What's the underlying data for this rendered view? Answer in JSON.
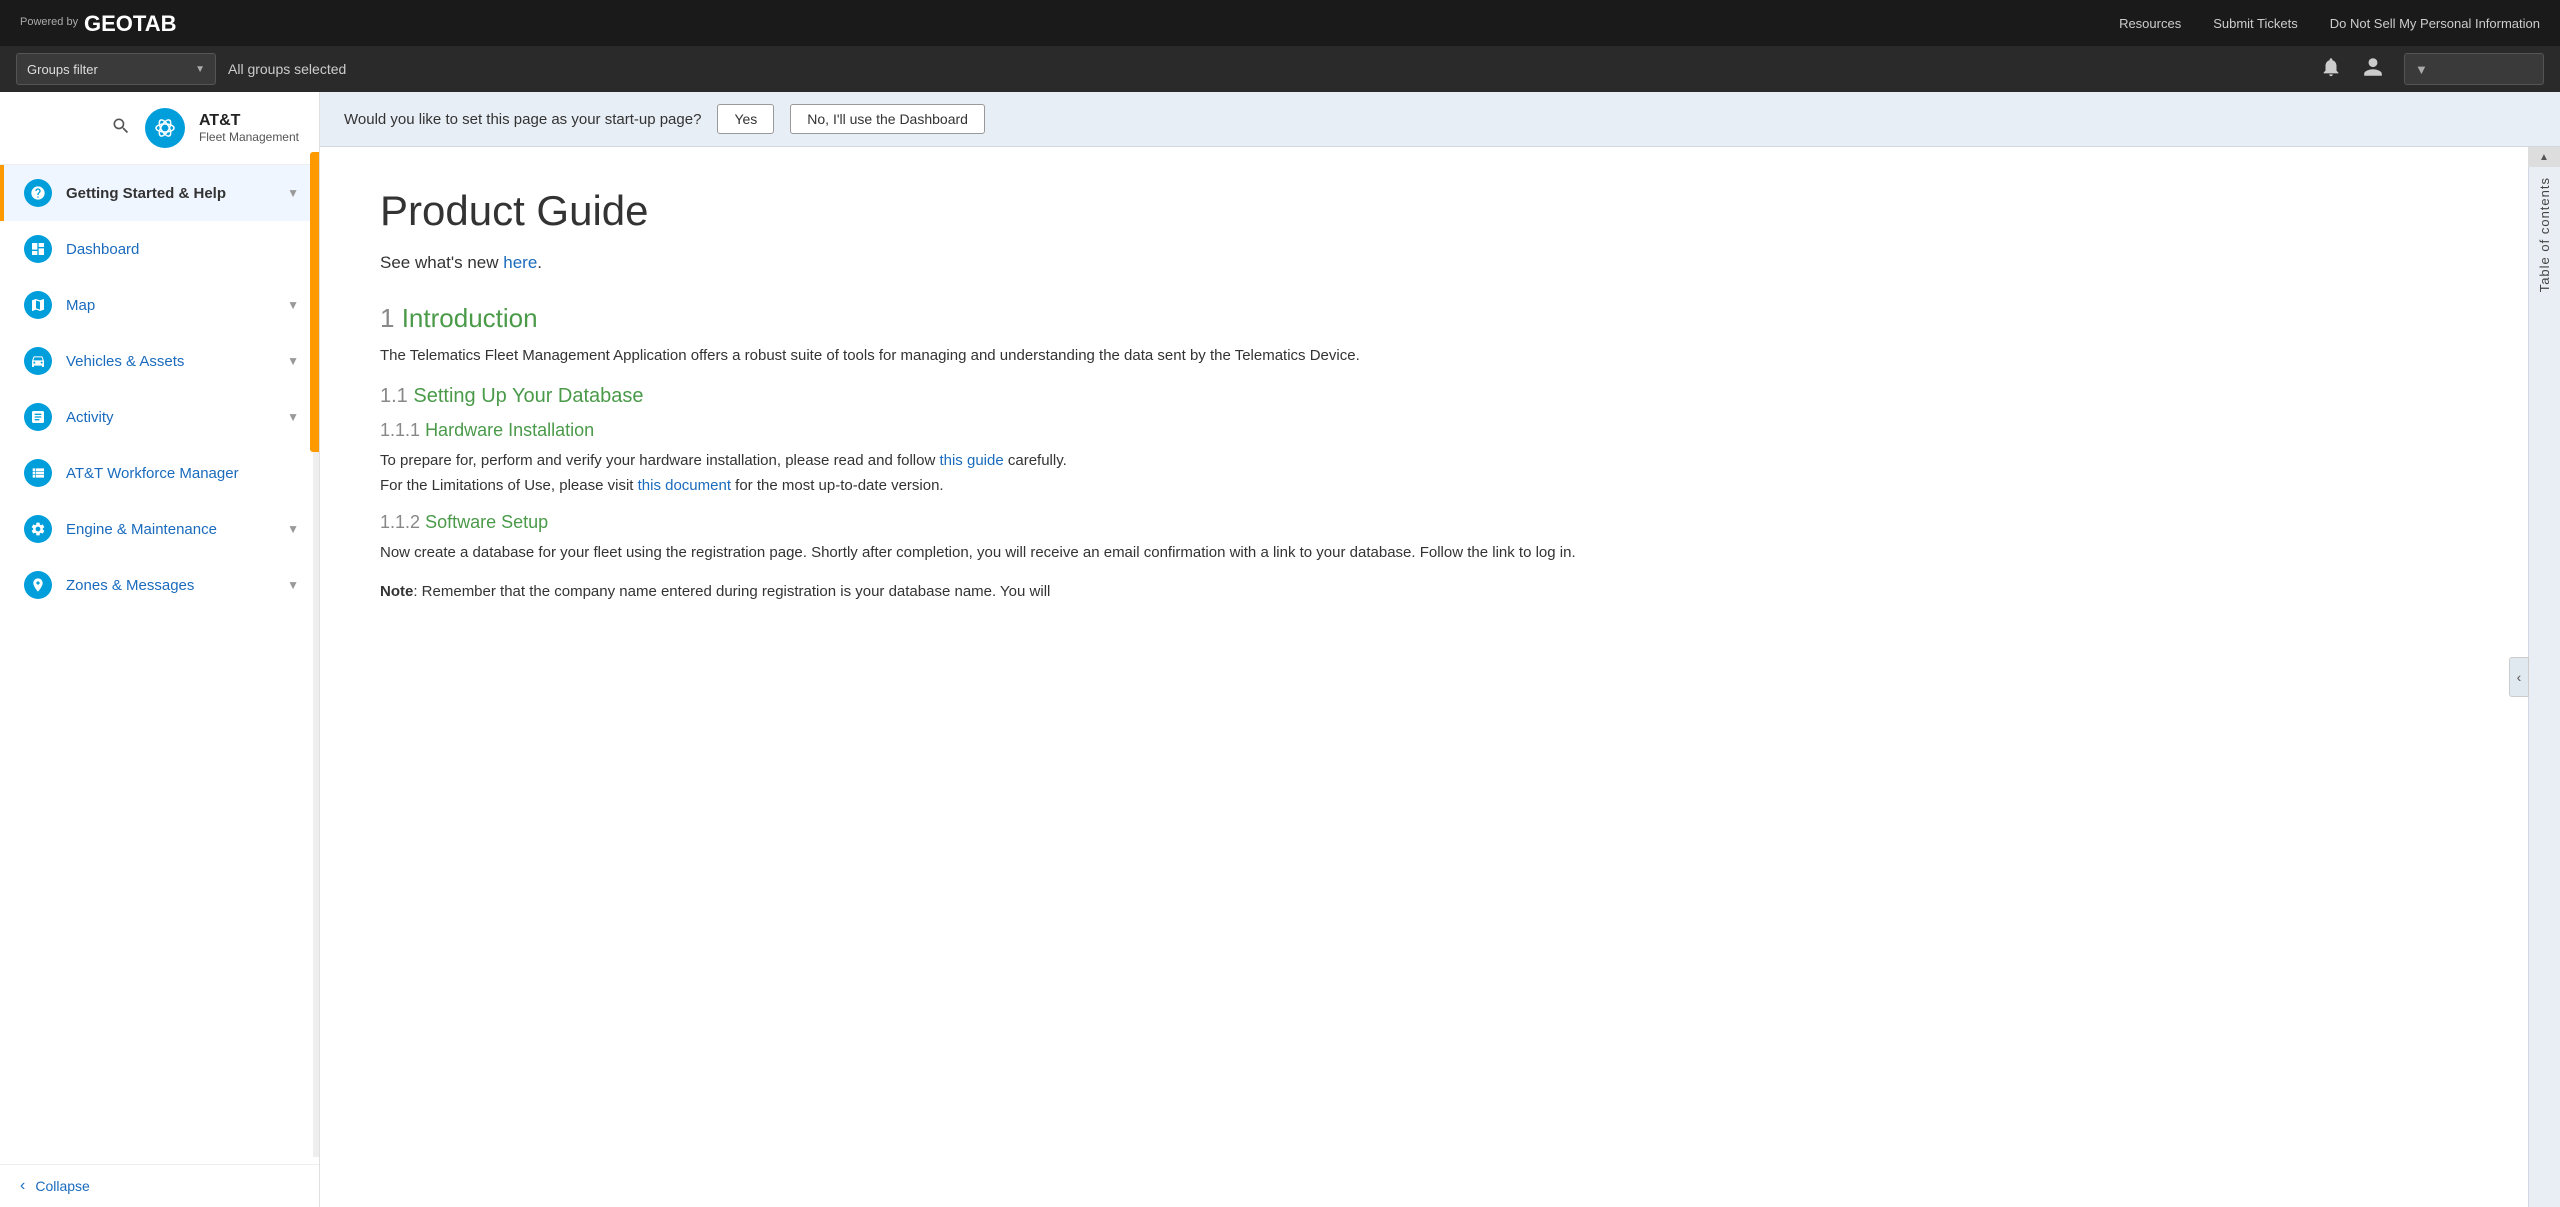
{
  "topbar": {
    "powered_by": "Powered\nby",
    "logo": "GEOTAB",
    "resources": "Resources",
    "submit_tickets": "Submit Tickets",
    "do_not_sell": "Do Not Sell My Personal Information"
  },
  "groups_bar": {
    "filter_label": "Groups filter",
    "dropdown_arrow": "▼",
    "all_groups": "All groups selected"
  },
  "sidebar": {
    "brand_name": "AT&T",
    "brand_sub": "Fleet Management",
    "nav_items": [
      {
        "id": "getting-started",
        "label": "Getting Started & Help",
        "active": true,
        "has_chevron": true
      },
      {
        "id": "dashboard",
        "label": "Dashboard",
        "active": false,
        "has_chevron": false
      },
      {
        "id": "map",
        "label": "Map",
        "active": false,
        "has_chevron": true
      },
      {
        "id": "vehicles",
        "label": "Vehicles & Assets",
        "active": false,
        "has_chevron": true
      },
      {
        "id": "activity",
        "label": "Activity",
        "active": false,
        "has_chevron": true
      },
      {
        "id": "workforce",
        "label": "AT&T Workforce Manager",
        "active": false,
        "has_chevron": false
      },
      {
        "id": "engine",
        "label": "Engine & Maintenance",
        "active": false,
        "has_chevron": true
      },
      {
        "id": "zones",
        "label": "Zones & Messages",
        "active": false,
        "has_chevron": true
      }
    ],
    "collapse_label": "Collapse"
  },
  "startup_banner": {
    "question": "Would you like to set this page as your start-up page?",
    "yes_btn": "Yes",
    "no_btn": "No, I'll use the Dashboard"
  },
  "toc": {
    "label": "Table of contents",
    "collapse_arrow": "‹"
  },
  "guide": {
    "title": "Product Guide",
    "subtitle_prefix": "See what's new ",
    "subtitle_link": "here",
    "subtitle_suffix": ".",
    "section1_num": "1",
    "section1_title": "Introduction",
    "section1_para": "The Telematics Fleet Management Application offers a robust suite of tools for managing and understanding the data sent by the Telematics Device.",
    "section11_num": "1.1",
    "section11_title": "Setting Up Your Database",
    "section111_num": "1.1.1",
    "section111_title": "Hardware Installation",
    "section111_para_prefix": "To prepare for, perform and verify your hardware installation, please read and follow ",
    "section111_link1": "this guide",
    "section111_para_mid": " carefully.\nFor the Limitations of Use, please visit ",
    "section111_link2": "this document",
    "section111_para_suffix": " for the most up-to-date version.",
    "section112_num": "1.1.2",
    "section112_title": "Software Setup",
    "section112_para": "Now create a database for your fleet using the registration page. Shortly after completion, you will receive an email confirmation with a link to your database. Follow the link to log in.",
    "section112_para2_prefix": "Note",
    "section112_para2_suffix": ": Remember that the company name entered during registration is your database name. You will"
  }
}
